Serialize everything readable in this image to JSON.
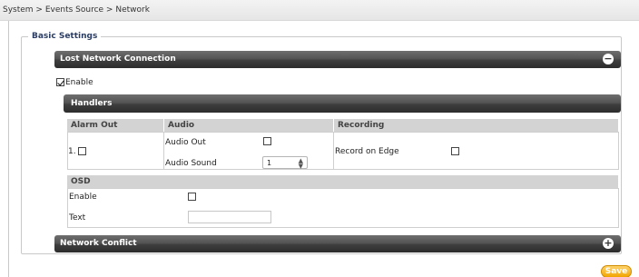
{
  "breadcrumb": "System > Events Source > Network",
  "basic_settings": {
    "legend": "Basic Settings",
    "lost_network": {
      "title": "Lost Network Connection",
      "collapse_icon": "minus-circle-icon",
      "enable_label": "Enable",
      "enable_checked": true,
      "handlers": {
        "title": "Handlers",
        "columns": [
          "Alarm Out",
          "Audio",
          "Recording"
        ],
        "alarm_out": {
          "label": "1.",
          "checked": false
        },
        "audio": {
          "audio_out_label": "Audio Out",
          "audio_out_checked": false,
          "audio_sound_label": "Audio Sound",
          "audio_sound_value": "1"
        },
        "recording": {
          "record_on_edge_label": "Record on Edge",
          "checked": false
        },
        "osd": {
          "title": "OSD",
          "enable_label": "Enable",
          "enable_checked": false,
          "text_label": "Text",
          "text_value": ""
        }
      }
    },
    "network_conflict": {
      "title": "Network Conflict",
      "expand_icon": "plus-circle-icon"
    }
  },
  "save_label": "Save",
  "colors": {
    "save_button": "#f1a400",
    "legend_text": "#2b3d63",
    "bar_dark": "#3e3e3e"
  }
}
